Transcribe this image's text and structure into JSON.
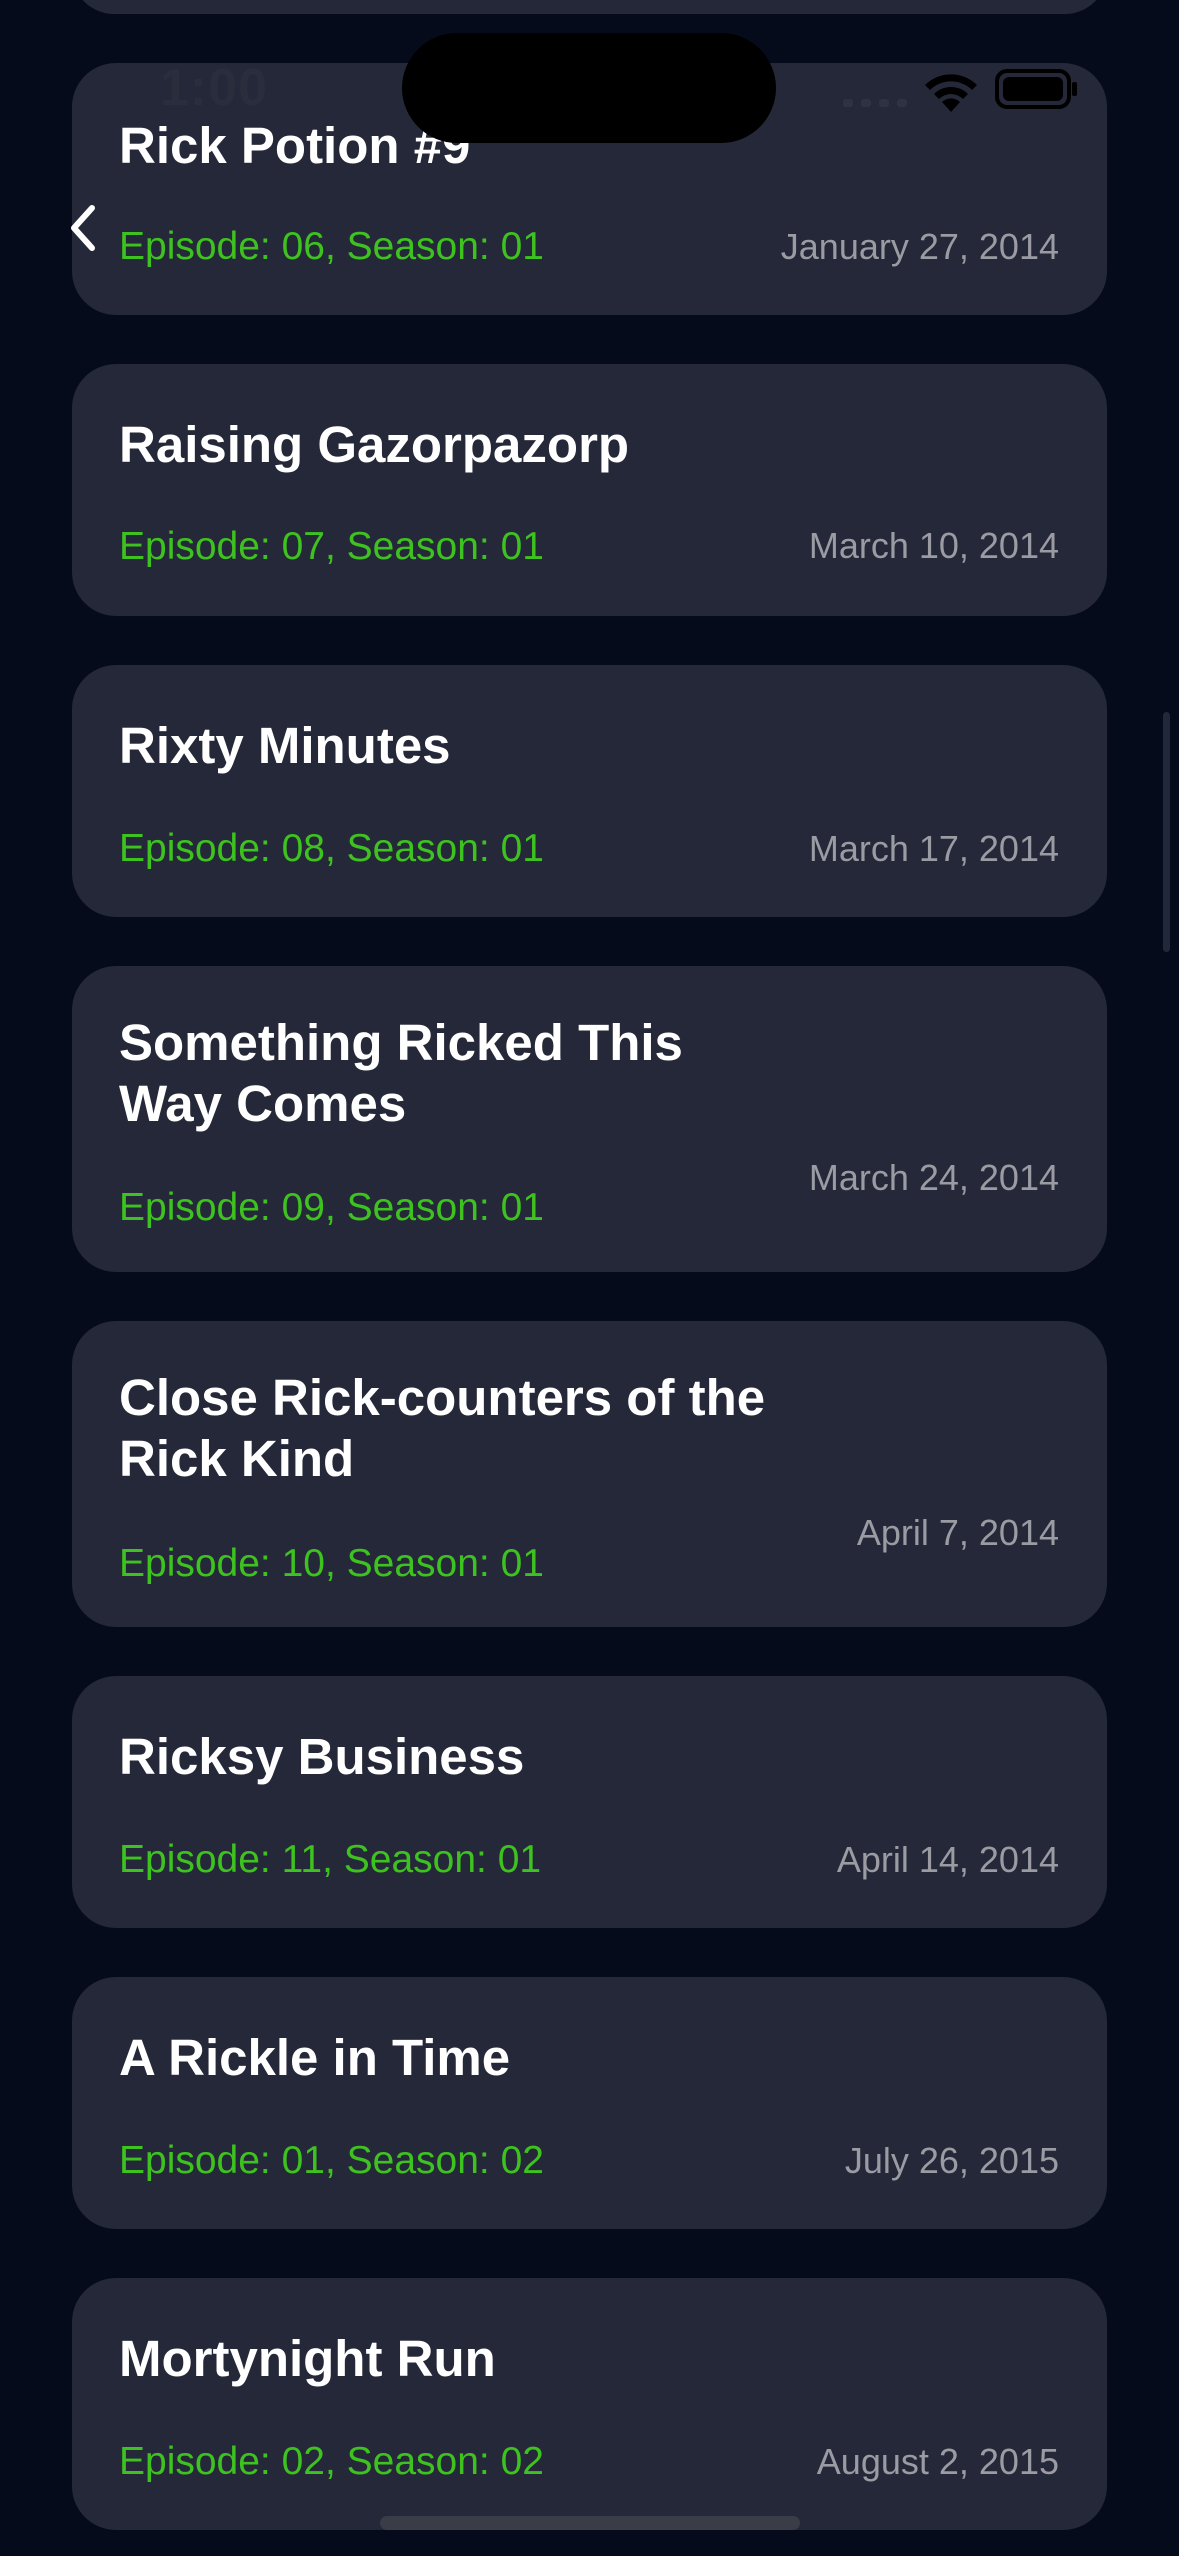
{
  "status_bar": {
    "time": "1:00"
  },
  "episodes": [
    {
      "title": "Rick Potion #9",
      "episode": "Episode: 06, Season: 01",
      "air_date": "January 27, 2014"
    },
    {
      "title": "Raising Gazorpazorp",
      "episode": "Episode: 07, Season: 01",
      "air_date": "March 10, 2014"
    },
    {
      "title": "Rixty Minutes",
      "episode": "Episode: 08, Season: 01",
      "air_date": "March 17, 2014"
    },
    {
      "title": "Something Ricked This Way Comes",
      "episode": "Episode: 09, Season: 01",
      "air_date": "March 24, 2014"
    },
    {
      "title": "Close Rick-counters of the Rick Kind",
      "episode": "Episode: 10, Season: 01",
      "air_date": "April 7, 2014"
    },
    {
      "title": "Ricksy Business",
      "episode": "Episode: 11, Season: 01",
      "air_date": "April 14, 2014"
    },
    {
      "title": "A Rickle in Time",
      "episode": "Episode: 01, Season: 02",
      "air_date": "July 26, 2015"
    },
    {
      "title": "Mortynight Run",
      "episode": "Episode: 02, Season: 02",
      "air_date": "August 2, 2015"
    }
  ],
  "colors": {
    "background": "#060b1b",
    "card": "#252838",
    "episode_text": "#3ec21f",
    "date_text": "#9a9ba3",
    "title_text": "#ffffff"
  },
  "icons": {
    "back": "chevron-left-icon",
    "signal": "cellular-signal-icon",
    "wifi": "wifi-icon",
    "battery": "battery-icon"
  }
}
